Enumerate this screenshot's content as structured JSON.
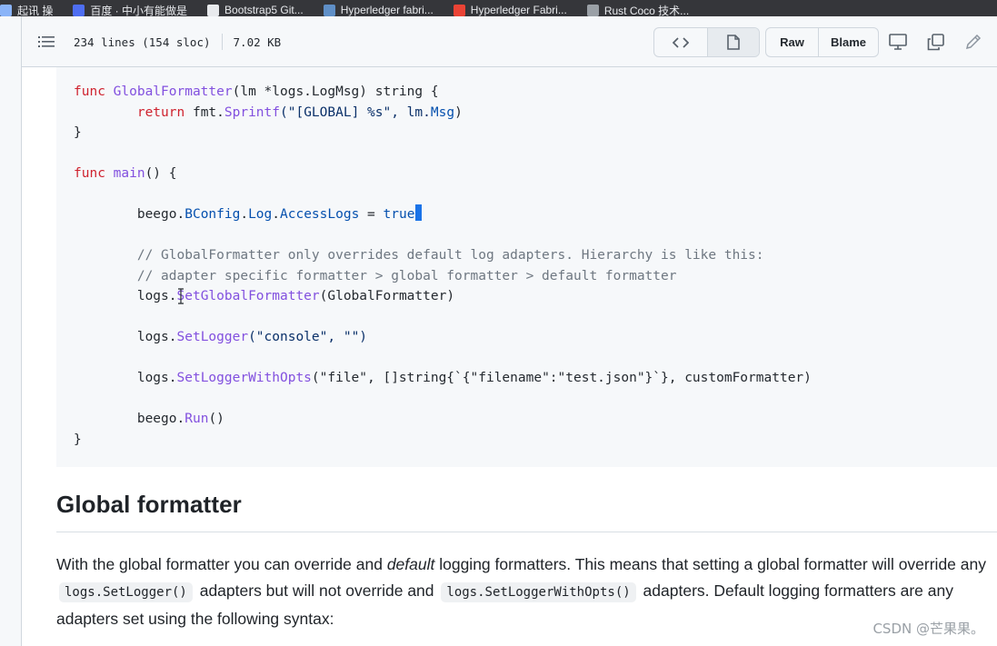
{
  "bookmarks": [
    {
      "label": "起讯 操",
      "color": "#8ab4f8"
    },
    {
      "label": "百度 · 中小有能做是",
      "color": "#4e6ef2"
    },
    {
      "label": "Bootstrap5 Git...",
      "color": "#e8eaed"
    },
    {
      "label": "Hyperledger fabri...",
      "color": "#5f8fc7"
    },
    {
      "label": "Hyperledger Fabri...",
      "color": "#ea4335"
    },
    {
      "label": "Rust Coco 技术...",
      "color": "#9aa0a6"
    }
  ],
  "file_header": {
    "lines": "234 lines (154 sloc)",
    "size": "7.02 KB",
    "raw_label": "Raw",
    "blame_label": "Blame"
  },
  "code": {
    "l1_kw": "func",
    "l1_fn": "GlobalFormatter",
    "l1_rest": "(lm *logs.LogMsg) string {",
    "l2_kw": "return",
    "l2_a": " fmt.",
    "l2_fn": "Sprintf",
    "l2_b": "(\"[GLOBAL] %s\", lm.",
    "l2_pk": "Msg",
    "l2_c": ")",
    "l3": "}",
    "l5_kw": "func",
    "l5_fn": "main",
    "l5_rest": "() {",
    "l7_a": "beego.",
    "l7_p1": "BConfig",
    "l7_dot1": ".",
    "l7_p2": "Log",
    "l7_dot2": ".",
    "l7_p3": "AccessLogs",
    "l7_eq": " = ",
    "l7_kw": "true",
    "l9_cm": "// GlobalFormatter only overrides default log adapters. Hierarchy is like this:",
    "l10_cm": "// adapter specific formatter > global formatter > default formatter",
    "l11_a": "logs.",
    "l11_fn": "SetGlobalFormatter",
    "l11_rest": "(GlobalFormatter)",
    "l13_a": "logs.",
    "l13_fn": "SetLogger",
    "l13_rest": "(\"console\", \"\")",
    "l15_a": "logs.",
    "l15_fn": "SetLoggerWithOpts",
    "l15_rest": "(\"file\", []string{`{\"filename\":\"test.json\"}`}, customFormatter)",
    "l17_a": "beego.",
    "l17_fn": "Run",
    "l17_rest": "()",
    "l18": "}"
  },
  "section": {
    "heading": "Global formatter",
    "p_a": "With the global formatter you can override and ",
    "p_em": "default",
    "p_b": " logging formatters. This means that setting a global formatter will override any ",
    "p_code1": "logs.SetLogger()",
    "p_c": " adapters but will not override and ",
    "p_code2": "logs.SetLoggerWithOpts()",
    "p_d": " adapters. Default logging formatters are any adapters set using the following syntax:"
  },
  "watermark": "CSDN @芒果果。",
  "colors": {
    "keyword": "#cf222e",
    "function": "#8250df",
    "property": "#0550ae",
    "comment": "#6e7781",
    "code_bg": "#f6f8fa",
    "cursor": "#1a73e8"
  }
}
